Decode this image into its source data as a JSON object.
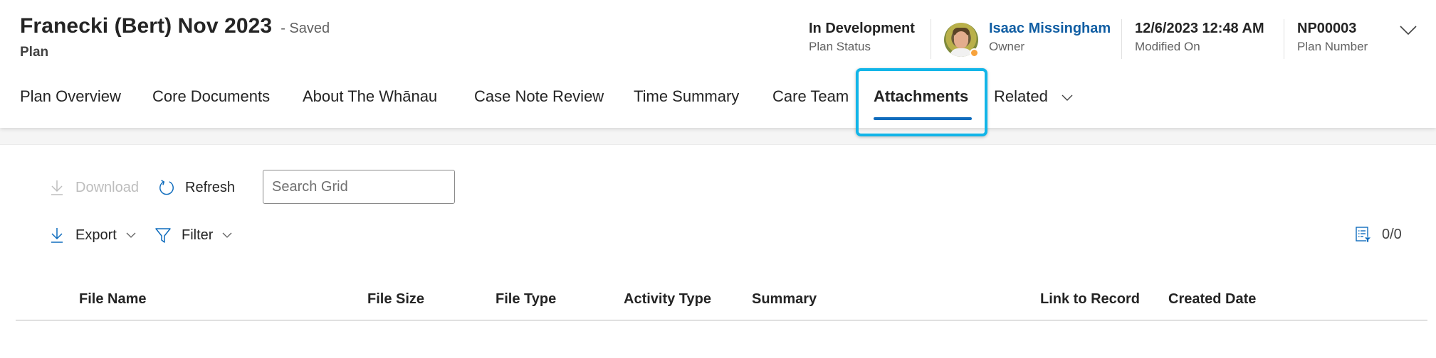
{
  "header": {
    "title": "Franecki (Bert) Nov 2023",
    "save_status": "- Saved",
    "entity_type": "Plan",
    "fields": {
      "status": {
        "value": "In Development",
        "label": "Plan Status"
      },
      "owner": {
        "value": "Isaac Missingham",
        "label": "Owner",
        "presence": "away",
        "presence_color": "#f7a23b"
      },
      "modified": {
        "value": "12/6/2023 12:48 AM",
        "label": "Modified On"
      },
      "number": {
        "value": "NP00003",
        "label": "Plan Number"
      }
    },
    "expand_icon": "chevron-down-icon"
  },
  "tabs": [
    {
      "label": "Plan Overview",
      "active": false
    },
    {
      "label": "Core Documents",
      "active": false
    },
    {
      "label": "About The Whānau",
      "active": false
    },
    {
      "label": "Case Note Review",
      "active": false
    },
    {
      "label": "Time Summary",
      "active": false
    },
    {
      "label": "Care Team",
      "active": false
    },
    {
      "label": "Attachments",
      "active": true
    },
    {
      "label": "Related",
      "active": false,
      "has_dropdown": true
    }
  ],
  "toolbar": {
    "download_label": "Download",
    "download_disabled": true,
    "refresh_label": "Refresh",
    "search_placeholder": "Search Grid",
    "search_value": "",
    "export_label": "Export",
    "filter_label": "Filter",
    "record_count": "0/0"
  },
  "grid": {
    "columns": [
      "File Name",
      "File Size",
      "File Type",
      "Activity Type",
      "Summary",
      "Link to Record",
      "Created Date"
    ],
    "rows": []
  },
  "colors": {
    "accent": "#0f6cbd",
    "link": "#115ea3",
    "highlight": "#12b5e8",
    "disabled_text": "#bdbdbd"
  }
}
